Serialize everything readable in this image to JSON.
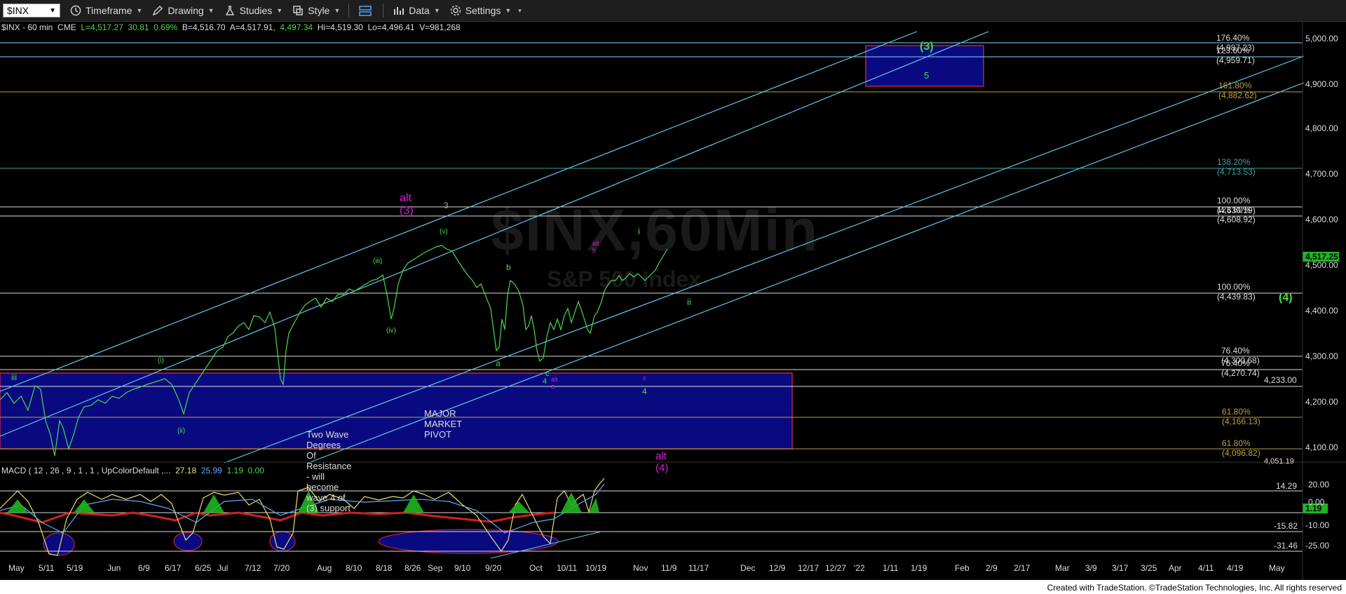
{
  "toolbar": {
    "symbol": "$INX",
    "timeframe": "Timeframe",
    "drawing": "Drawing",
    "studies": "Studies",
    "style": "Style",
    "data": "Data",
    "settings": "Settings"
  },
  "info": {
    "symbol": "$INX - 60 min",
    "exchange": "CME",
    "last": "L=4,517.27",
    "change": "30.81",
    "pct": "0.69%",
    "bid": "B=4,516.70",
    "ask": "A=4,517.91",
    "close": "4,497.34",
    "high": "Hi=4,519.30",
    "low": "Lo=4,496.41",
    "volume": "V=981,268"
  },
  "watermark": {
    "main": "$INX,60Min",
    "sub": "S&P 500 Index"
  },
  "price_axis": [
    "5,000.00",
    "4,900.00",
    "4,800.00",
    "4,700.00",
    "4,600.00",
    "4,500.00",
    "4,400.00",
    "4,300.00",
    "4,200.00",
    "4,100.00"
  ],
  "current_price": "4,517.25",
  "fib_levels": [
    {
      "label": "176.40% (4,987.23)",
      "color": "#7fd3ff"
    },
    {
      "label": "123.60% (4,959.71)",
      "color": "#7fd3ff"
    },
    {
      "label": "161.80% (4,882.62)",
      "color": "#b8a040"
    },
    {
      "label": "138.20% (4,713.53)",
      "color": "#3aa0a0"
    },
    {
      "label": "100.00% (4,630.19)",
      "color": "#dddddd"
    },
    {
      "label": "123.60% (4,608.92)",
      "color": "#dddddd"
    },
    {
      "label": "100.00% (4,439.83)",
      "color": "#dddddd"
    },
    {
      "label": "76.40% (4,300.68)",
      "color": "#dddddd"
    },
    {
      "label": "76.40% (4,270.74)",
      "color": "#dddddd"
    },
    {
      "label": "4,233.00",
      "color": "#dddddd"
    },
    {
      "label": "61.80% (4,166.13)",
      "color": "#b8a040"
    },
    {
      "label": "61.80% (4,096.82)",
      "color": "#b8a040"
    },
    {
      "label": "4,051.19",
      "color": "#dddddd"
    }
  ],
  "annotations": {
    "alt3": "alt (3)",
    "wave3_top": "(3)",
    "wave5": "5",
    "alt4": "alt (4)",
    "wave4_green": "(4)",
    "altb": "alt b",
    "alta": "alt a",
    "pivot": "MAJOR MARKET PIVOT",
    "pivot_sub": "Two Wave Degrees Of Resistance - will become wave 4 of (3) support",
    "w_i": "i",
    "w_ii": "ii",
    "w_iii_left": "iii",
    "w_3": "3",
    "w_v": "(v)",
    "w_iii": "(iii)",
    "w_iv": "(iv)",
    "w_i_paren": "(i)",
    "w_ii_paren": "(ii)",
    "w_a": "a",
    "w_b": "b",
    "w_c": "c",
    "w_4": "4",
    "w_4b": "4",
    "w_c2": "c"
  },
  "macd": {
    "label": "MACD ( 12 , 26 , 9 , 1 , 1 , UpColorDefault ,...",
    "v1": "27.18",
    "v2": "25.99",
    "v3": "1.19",
    "v4": "0.00",
    "axis": [
      "20.00",
      "0.00",
      "-10.00",
      "-25.00"
    ],
    "levels": [
      "14.29",
      "1.19",
      "-15.82",
      "-31.46"
    ]
  },
  "dates": [
    "May",
    "5/11",
    "5/19",
    "Jun",
    "6/9",
    "6/17",
    "6/25",
    "Jul",
    "7/12",
    "7/20",
    "Aug",
    "8/10",
    "8/18",
    "8/26",
    "Sep",
    "9/10",
    "9/20",
    "Oct",
    "10/11",
    "10/19",
    "Nov",
    "11/9",
    "11/17",
    "Dec",
    "12/9",
    "12/17",
    "12/27",
    "'22",
    "1/11",
    "1/19",
    "Feb",
    "2/9",
    "2/17",
    "Mar",
    "3/9",
    "3/17",
    "3/25",
    "Apr",
    "4/11",
    "4/19",
    "May"
  ],
  "footer": "Created with TradeStation. ©TradeStation Technologies, Inc. All rights reserved",
  "colors": {
    "wave_green": "#4bd84b",
    "alt_magenta": "#d020d0",
    "box_blue": "#0a0a80",
    "channel": "#5fc8e8"
  }
}
